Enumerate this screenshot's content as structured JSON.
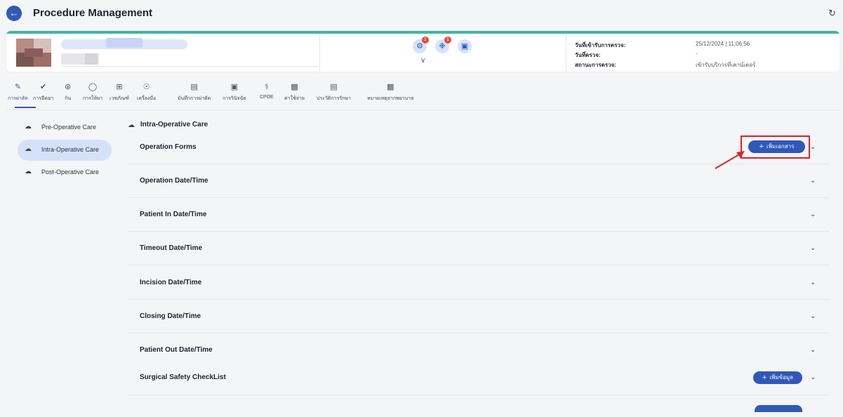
{
  "header": {
    "title": "Procedure Management"
  },
  "patient": {
    "admit_label": "วันที่เข้ารับการตรวจ:",
    "admit_value": "25/12/2024 | 11:06:56",
    "exam_label": "วันที่ตรวจ:",
    "exam_value": "-",
    "location_label": "สถานะการตรวจ:",
    "location_value": "เข้ารับบริการที่เคาน์เตอร์",
    "badges": [
      "1",
      "1"
    ]
  },
  "toolbar": {
    "items": [
      {
        "label": "การผ่าตัด",
        "icon": "scalpel-icon"
      },
      {
        "label": "การฉีดยา",
        "icon": "syringe-icon"
      },
      {
        "label": "กิน",
        "icon": "group-icon"
      },
      {
        "label": "การให้ยา",
        "icon": "pill-icon"
      },
      {
        "label": "เวชภัณฑ์",
        "icon": "grid-icon"
      },
      {
        "label": "เครื่องมือ",
        "icon": "tool-icon"
      },
      {
        "label": "บันทึกการผ่าตัด",
        "icon": "notes-icon"
      },
      {
        "label": "การวินิจฉัย",
        "icon": "clipboard-icon"
      },
      {
        "label": "CPOE",
        "icon": "stethoscope-icon"
      },
      {
        "label": "ค่าใช้จ่าย",
        "icon": "receipt-icon"
      },
      {
        "label": "ประวัติการรักษา",
        "icon": "history-icon"
      },
      {
        "label": "หมายเหตุจากพยาบาล",
        "icon": "nurse-note-icon"
      }
    ]
  },
  "sidebar": {
    "items": [
      {
        "label": "Pre-Operative Care"
      },
      {
        "label": "Intra-Operative Care"
      },
      {
        "label": "Post-Operative Care"
      }
    ]
  },
  "main": {
    "section_title": "Intra-Operative Care",
    "add_document_label": "เพิ่มเอกสาร",
    "add_data_label": "เพิ่มข้อมูล",
    "rows": [
      {
        "label": "Operation Forms"
      },
      {
        "label": "Operation Date/Time"
      },
      {
        "label": "Patient In Date/Time"
      },
      {
        "label": "Timeout Date/Time"
      },
      {
        "label": "Incision Date/Time"
      },
      {
        "label": "Closing Date/Time"
      },
      {
        "label": "Patient Out Date/Time"
      },
      {
        "label": "Surgical Safety CheckList"
      }
    ]
  }
}
